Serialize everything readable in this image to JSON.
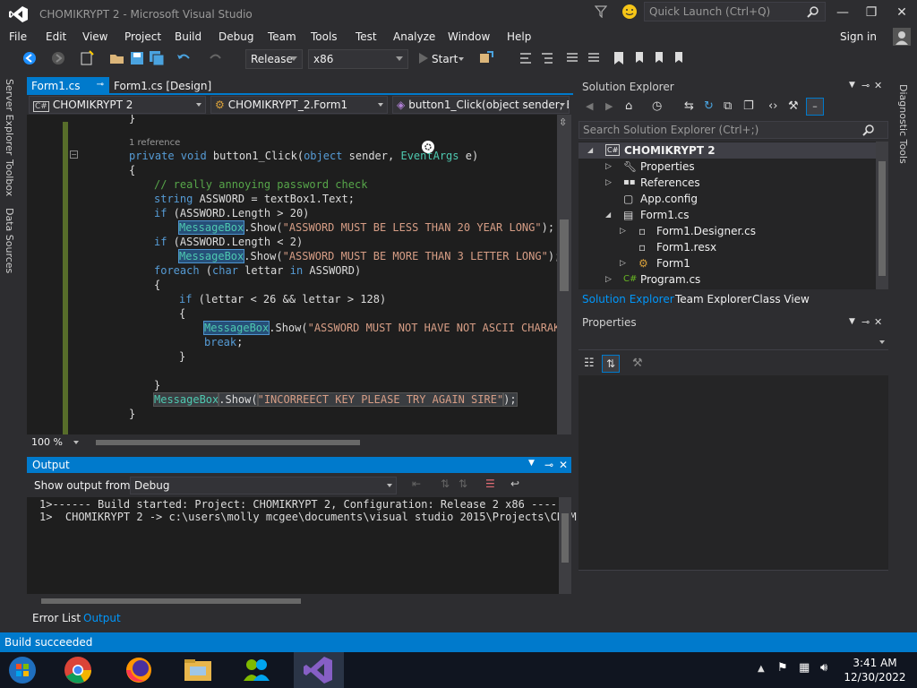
{
  "window": {
    "title": "CHOMIKRYPT 2 - Microsoft Visual Studio",
    "quick_launch_placeholder": "Quick Launch (Ctrl+Q)",
    "sign_in": "Sign in"
  },
  "menu": [
    "File",
    "Edit",
    "View",
    "Project",
    "Build",
    "Debug",
    "Team",
    "Tools",
    "Test",
    "Analyze",
    "Window",
    "Help"
  ],
  "toolbar": {
    "config": "Release",
    "platform": "x86",
    "start": "Start"
  },
  "left_tabs": [
    "Server Explorer",
    "Toolbox",
    "Data Sources"
  ],
  "right_tabs": [
    "Diagnostic Tools"
  ],
  "doc_tabs": [
    {
      "label": "Form1.cs",
      "active": true
    },
    {
      "label": "Form1.cs [Design]",
      "active": false
    }
  ],
  "nav": {
    "project": "CHOMIKRYPT 2",
    "class": "CHOMIKRYPT_2.Form1",
    "member": "button1_Click(object sender, E"
  },
  "code": {
    "ref": "1 reference",
    "brace_top": "}",
    "decl_kw": "private void",
    "decl_name": " button1_Click(",
    "decl_kw2": "object",
    "decl_mid": " sender, ",
    "decl_type": "EventArgs",
    "decl_end": " e)",
    "open": "{",
    "comment": "// really annoying password check",
    "l_string_kw": "string",
    "l_string_rest": " ASSWORD = textBox1.Text;",
    "if1_kw": "if",
    "if1_rest": " (ASSWORD.Length > 20)",
    "mb": "MessageBox",
    "show": ".Show(",
    "str1": "\"ASSWORD MUST BE LESS THAN 20 YEAR LONG\"",
    "end": ");",
    "if2_kw": "if",
    "if2_rest": " (ASSWORD.Length < 2)",
    "str2": "\"ASSWORD MUST BE MORE THAN 3 LETTER LONG\"",
    "foreach_kw": "foreach",
    "foreach_mid": " (",
    "char_kw": "char",
    "foreach_var": " lettar ",
    "in_kw": "in",
    "foreach_end": " ASSWORD)",
    "open2": "{",
    "if3_kw": "if",
    "if3_rest": " (lettar < 26 && lettar > 128)",
    "open3": "{",
    "str3": "\"ASSWORD MUST NOT HAVE NOT ASCII CHARAKT",
    "break_kw": "break",
    "semi": ";",
    "close3": "}",
    "close2": "}",
    "str4": "\"INCORREECT KEY PLEASE TRY AGAIN SIRE\"",
    "close1": "}"
  },
  "zoom": "100 %",
  "output": {
    "title": "Output",
    "show_from_label": "Show output from:",
    "show_from_value": "Debug",
    "lines": [
      "1>------ Build started: Project: CHOMIKRYPT 2, Configuration: Release 2 x86 ------",
      "1>  CHOMIKRYPT 2 -> c:\\users\\molly mcgee\\documents\\visual studio 2015\\Projects\\CHOM"
    ]
  },
  "bottom_tabs": [
    "Error List",
    "Output"
  ],
  "solution_explorer": {
    "title": "Solution Explorer",
    "search_placeholder": "Search Solution Explorer (Ctrl+;)",
    "project": "CHOMIKRYPT 2",
    "items": [
      "Properties",
      "References",
      "App.config",
      "Form1.cs",
      "Form1.Designer.cs",
      "Form1.resx",
      "Form1",
      "Program.cs"
    ],
    "tabs": [
      "Solution Explorer",
      "Team Explorer",
      "Class View"
    ]
  },
  "properties": {
    "title": "Properties"
  },
  "status": "Build succeeded",
  "clock": {
    "time": "3:41 AM",
    "date": "12/30/2022"
  },
  "colors": {
    "accent": "#007acc",
    "bg": "#2d2d30",
    "editor": "#1e1e1e"
  }
}
